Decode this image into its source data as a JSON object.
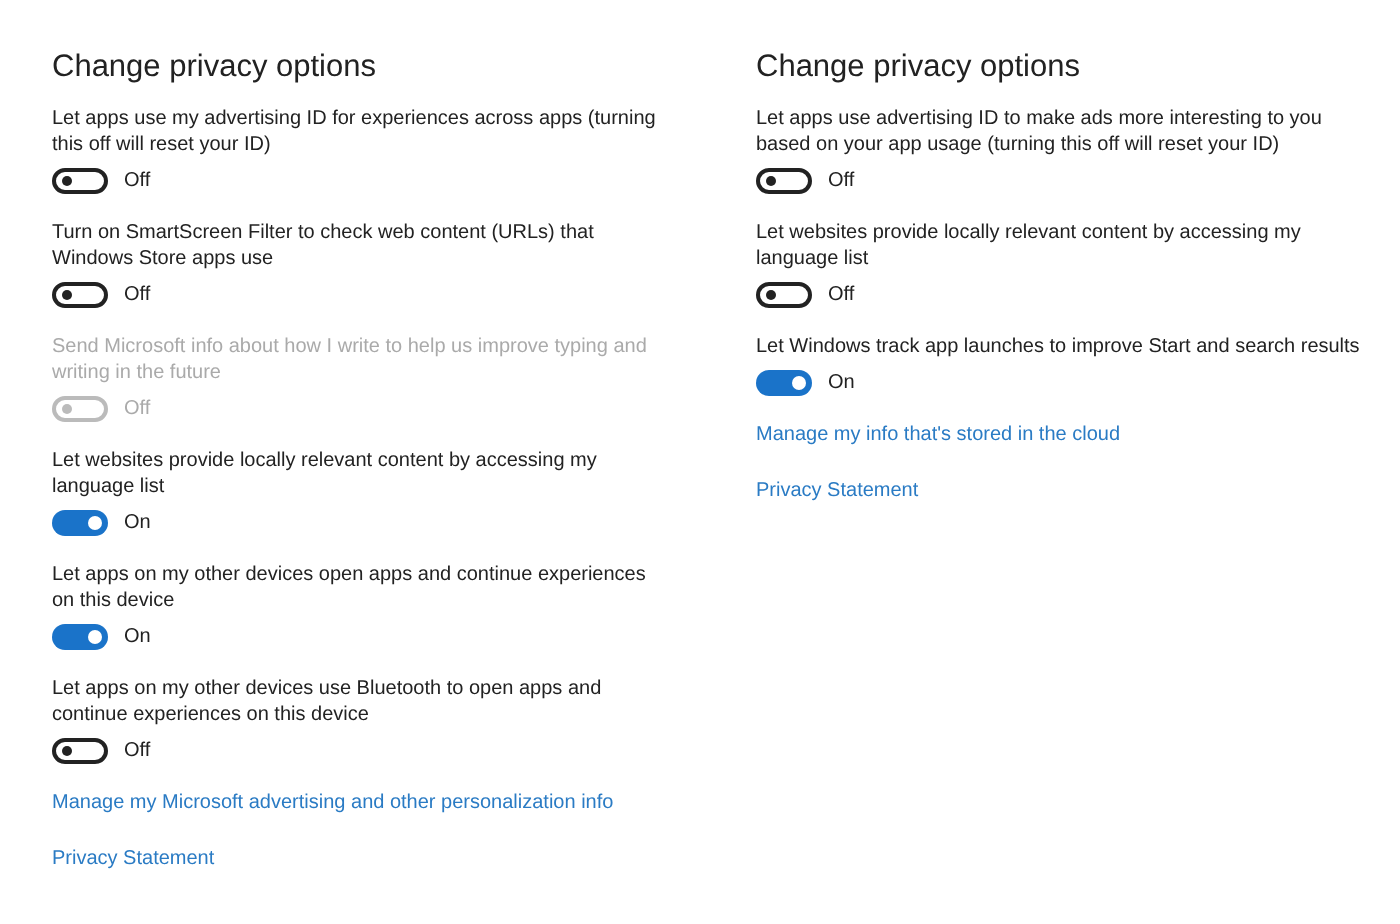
{
  "panels": [
    {
      "title": "Change privacy options",
      "options": [
        {
          "label": "Let apps use my advertising ID for experiences across apps (turning this off will reset your ID)",
          "on": false,
          "disabled": false,
          "state_text": "Off"
        },
        {
          "label": "Turn on SmartScreen Filter to check web content (URLs) that Windows Store apps use",
          "on": false,
          "disabled": false,
          "state_text": "Off"
        },
        {
          "label": "Send Microsoft info about how I write to help us improve typing and writing in the future",
          "on": false,
          "disabled": true,
          "state_text": "Off"
        },
        {
          "label": "Let websites provide locally relevant content by accessing my language list",
          "on": true,
          "disabled": false,
          "state_text": "On"
        },
        {
          "label": "Let apps on my other devices open apps and continue experiences on this device",
          "on": true,
          "disabled": false,
          "state_text": "On"
        },
        {
          "label": "Let apps on my other devices use Bluetooth to open apps and continue experiences on this device",
          "on": false,
          "disabled": false,
          "state_text": "Off"
        }
      ],
      "links": [
        "Manage my Microsoft advertising and other personalization info",
        "Privacy Statement"
      ]
    },
    {
      "title": "Change privacy options",
      "options": [
        {
          "label": "Let apps use advertising ID to make ads more interesting to you based on your app usage (turning this off will reset your ID)",
          "on": false,
          "disabled": false,
          "state_text": "Off"
        },
        {
          "label": "Let websites provide locally relevant content by accessing my language list",
          "on": false,
          "disabled": false,
          "state_text": "Off"
        },
        {
          "label": "Let Windows track app launches to improve Start and search results",
          "on": true,
          "disabled": false,
          "state_text": "On"
        }
      ],
      "links": [
        "Manage my info that's stored in the cloud",
        "Privacy Statement"
      ]
    }
  ]
}
